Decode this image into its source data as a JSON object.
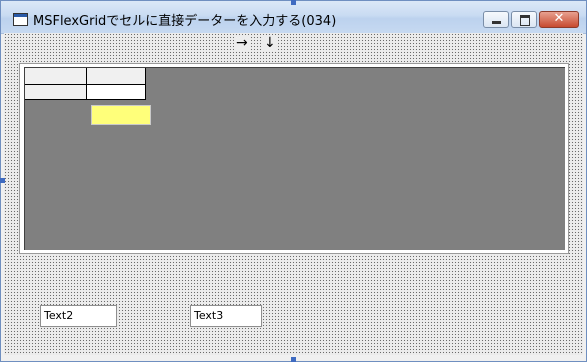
{
  "window": {
    "title": "MSFlexGridでセルに直接データーを入力する(034)",
    "close_glyph": "✕"
  },
  "form": {
    "label_right_arrow": "→",
    "label_down_arrow": "↓"
  },
  "textboxes": {
    "text2": "Text2",
    "text3": "Text3"
  },
  "colors": {
    "grid_background": "#808080",
    "edit_box": "#ffff7a",
    "titlebar": "#c9dbf2"
  }
}
